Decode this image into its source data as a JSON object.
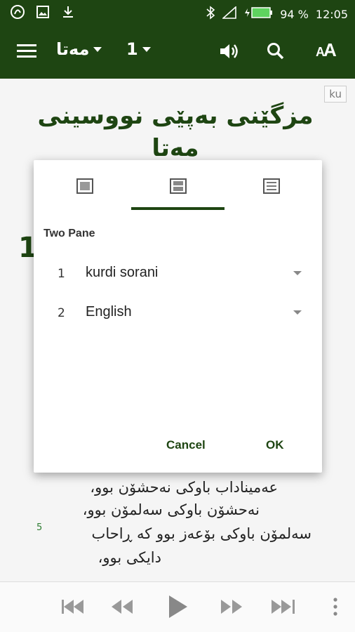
{
  "status_bar": {
    "battery": "94 %",
    "time": "12:05",
    "icons": [
      "app-logo-icon",
      "image-icon",
      "download-icon",
      "bluetooth-icon",
      "signal-icon",
      "battery-icon"
    ]
  },
  "app_bar": {
    "book": "مەتا",
    "chapter": "1",
    "font_button": "AA"
  },
  "content": {
    "language_tag": "ku",
    "title": "مزگێنی بەپێی نووسینی مەتا",
    "chapter_number": "1",
    "verses": [
      {
        "text": "عەمیناداب باوکی نەحشۆن بوو،"
      },
      {
        "text": "نەحشۆن باوکی سەلمۆن بوو،"
      },
      {
        "num": "5",
        "text": "سەلمۆن باوکی بۆعەز بوو کە ڕاحاب"
      },
      {
        "text": "دایکی بوو،"
      }
    ]
  },
  "dialog": {
    "tabs": [
      "single-pane",
      "two-pane",
      "interlinear"
    ],
    "selected_tab": 1,
    "pane_label": "Two Pane",
    "rows": [
      {
        "num": "1",
        "name": "kurdi sorani"
      },
      {
        "num": "2",
        "name": "English"
      }
    ],
    "cancel_label": "Cancel",
    "ok_label": "OK"
  },
  "colors": {
    "primary": "#1e4512",
    "background": "#f5f5f5"
  }
}
